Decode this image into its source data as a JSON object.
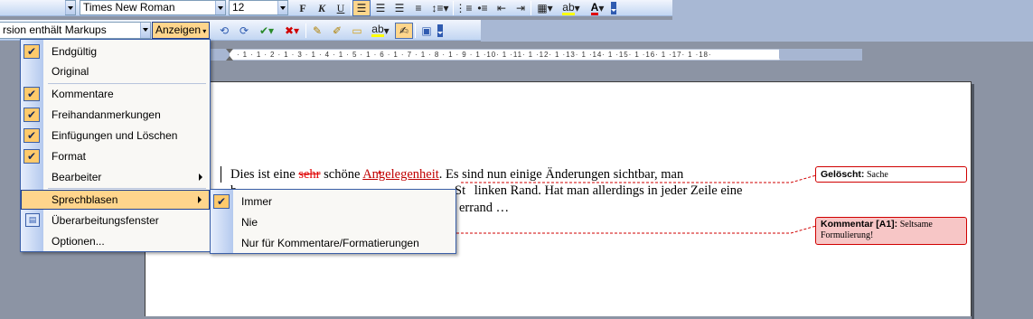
{
  "toolbar": {
    "font_name": "Times New Roman",
    "font_size": "12",
    "bold_label": "F",
    "italic_label": "K",
    "underline_label": "U",
    "markup_view": "rsion enthält Markups",
    "show_button": "Anzeigen"
  },
  "ruler": {
    "ticks": "· 1 · 1 · 2 · 1 · 3 · 1 · 4 · 1 · 5 · 1 · 6 · 1 · 7 · 1 · 8 · 1 · 9 · 1 ·10· 1 ·11· 1 ·12· 1 ·13· 1 ·14· 1 ·15· 1 ·16· 1 ·17· 1 ·18·"
  },
  "document": {
    "line1_a": "Dies ist eine ",
    "line1_deleted": "sehr",
    "line1_b": " schöne ",
    "line1_inserted": "Angelegenheit",
    "line1_c": ". Es sind nun einige Änderungen sichtbar, man",
    "line2_a": "b",
    "line2_b": "St",
    "line2_c": "linken Rand. Hat man allerdings in jeder Zeile eine",
    "line3": "errand …"
  },
  "balloons": {
    "deleted_label": "Gelöscht:",
    "deleted_text": "Sache",
    "comment_label": "Kommentar [A1]:",
    "comment_text_1": "Seltsame",
    "comment_text_2": "Formulierung!"
  },
  "menu_show": {
    "items": [
      {
        "label": "Endgültig",
        "checked": true
      },
      {
        "label": "Original",
        "checked": false
      },
      {
        "label": "Kommentare",
        "checked": true
      },
      {
        "label": "Freihandanmerkungen",
        "checked": true
      },
      {
        "label": "Einfügungen und Löschen",
        "checked": true
      },
      {
        "label": "Format",
        "checked": true
      },
      {
        "label": "Bearbeiter",
        "checked": false
      },
      {
        "label": "Sprechblasen",
        "checked": false
      },
      {
        "label": "Überarbeitungsfenster",
        "checked": false
      },
      {
        "label": "Optionen...",
        "checked": false
      }
    ]
  },
  "menu_balloons": {
    "items": [
      {
        "label": "Immer",
        "checked": true
      },
      {
        "label": "Nie",
        "checked": false
      },
      {
        "label": "Nur für Kommentare/Formatierungen",
        "checked": false
      }
    ]
  },
  "colors": {
    "revision_red": "#d00000",
    "menu_highlight": "#ffd58c",
    "office_blue": "#3a5fa8"
  }
}
